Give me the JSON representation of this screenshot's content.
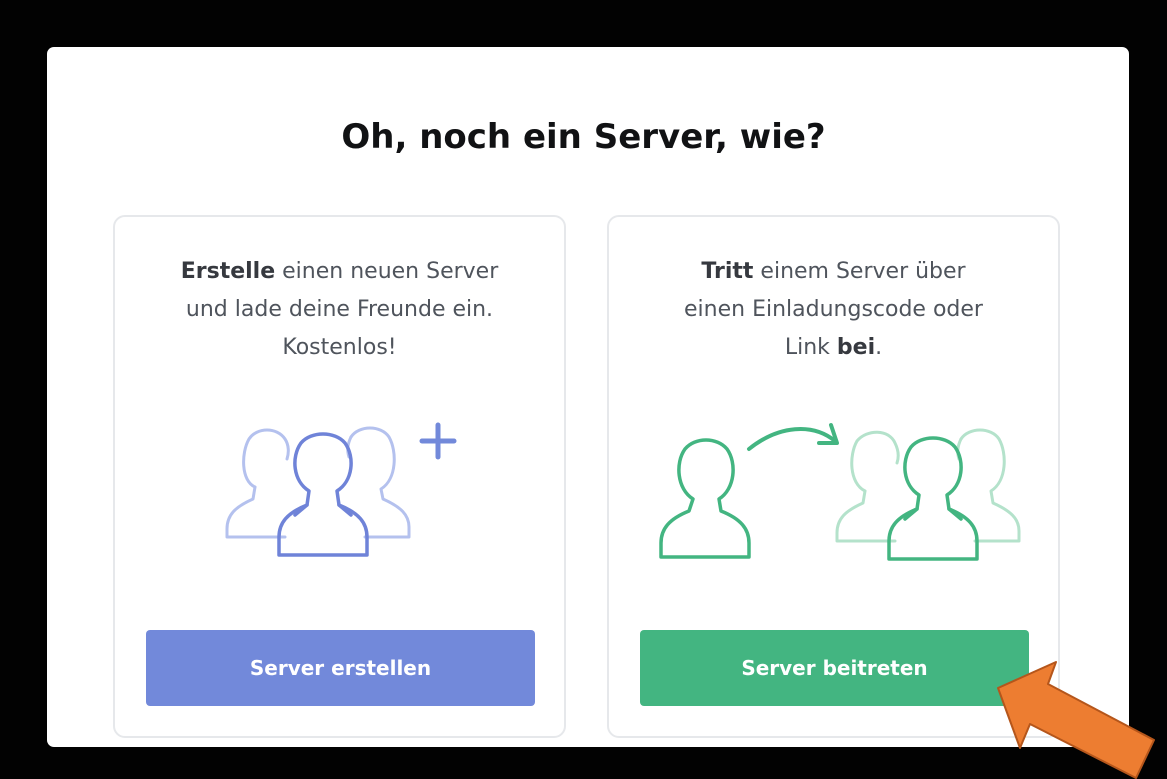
{
  "modal": {
    "title": "Oh, noch ein Server, wie?"
  },
  "create_card": {
    "desc_bold": "Erstelle",
    "desc_line1_rest": " einen neuen Server",
    "desc_line2": "und lade deine Freunde ein.",
    "desc_line3": "Kostenlos!",
    "illustration": "create-server-people-plus-icon",
    "button_label": "Server erstellen",
    "button_color": "#7289da"
  },
  "join_card": {
    "desc_bold": "Tritt",
    "desc_line1_rest": " einem Server über",
    "desc_line2": "einen Einladungscode oder",
    "desc_line3_pre": "Link ",
    "desc_line3_bold": "bei",
    "desc_line3_post": ".",
    "illustration": "join-server-person-arrow-group-icon",
    "button_label": "Server beitreten",
    "button_color": "#43b581"
  },
  "annotation": {
    "pointer": "orange-arrow-pointer",
    "color": "#ed7d31"
  }
}
